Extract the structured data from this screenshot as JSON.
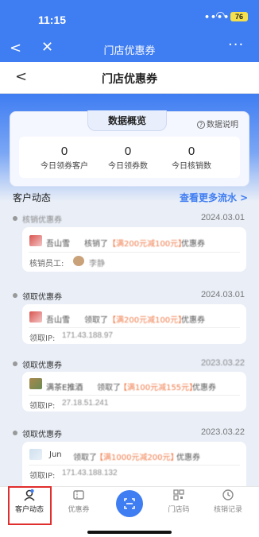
{
  "status_bar": {
    "time": "11:15",
    "battery": "76"
  },
  "app_nav": {
    "title": "门店优惠券",
    "back_glyph": "<",
    "close_glyph": "✕",
    "more_glyph": "···"
  },
  "page_nav": {
    "title": "门店优惠券",
    "back_glyph": "<"
  },
  "overview": {
    "tab_label": "数据概览",
    "explain_label": "数据说明",
    "stats": [
      {
        "value": "0",
        "label": "今日领券客户"
      },
      {
        "value": "0",
        "label": "今日领券数"
      },
      {
        "value": "0",
        "label": "今日核销数"
      }
    ]
  },
  "activity": {
    "section_title": "客户动态",
    "more_link": "查看更多流水 >",
    "entries": [
      {
        "type": "核销优惠券",
        "date": "2024.03.01",
        "name": "吾山雪",
        "action": "核销了",
        "coupon": "【满200元减100元】",
        "suffix": "优惠券",
        "info_label": "核销员工:",
        "info_value": "李静"
      },
      {
        "type": "领取优惠券",
        "date": "2024.03.01",
        "name": "吾山雪",
        "action": "领取了",
        "coupon": "【满200元减100元】",
        "suffix": "优惠券",
        "info_label": "领取IP:",
        "info_value": "171.43.188.97"
      },
      {
        "type": "领取优惠券",
        "date": "2023.03.22",
        "name": "满茶E推酒",
        "action": "领取了",
        "coupon": "【满100元减155元】",
        "suffix": "优惠券",
        "info_label": "领取IP:",
        "info_value": "27.18.51.241"
      },
      {
        "type": "领取优惠券",
        "date": "2023.03.22",
        "name": "Jun",
        "action": "领取了",
        "coupon": "【满1000元减200元】",
        "suffix": "优惠券",
        "info_label": "领取IP:",
        "info_value": "171.43.188.132"
      }
    ]
  },
  "tabbar": {
    "tabs": [
      {
        "label": "客户动态",
        "icon": "customer-activity-icon"
      },
      {
        "label": "优惠券",
        "icon": "coupon-icon"
      },
      {
        "label": "",
        "icon": "scan-icon"
      },
      {
        "label": "门店码",
        "icon": "qr-code-icon"
      },
      {
        "label": "核销记录",
        "icon": "history-icon"
      }
    ]
  },
  "colors": {
    "brand": "#3f7df2",
    "coupon_text": "#f07b4a",
    "highlight": "#e02d2d"
  }
}
